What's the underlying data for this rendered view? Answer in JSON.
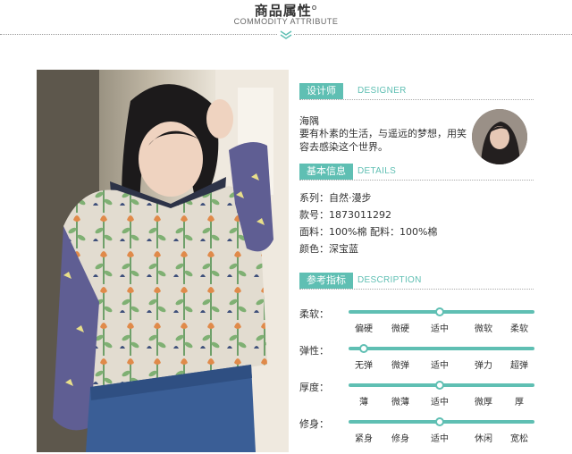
{
  "header": {
    "title": "商品属性",
    "title_mark": "o",
    "subtitle": "COMMODITY ATTRIBUTE"
  },
  "photo": {
    "icon": "model-photo-icon"
  },
  "designer": {
    "tag": "设计师",
    "tag_en": "DESIGNER",
    "name": "海隅",
    "desc": "要有朴素的生活，与遥远的梦想，用笑容去感染这个世界。",
    "avatar_icon": "designer-avatar-icon"
  },
  "details": {
    "tag": "基本信息",
    "tag_en": "DETAILS",
    "rows": [
      "系列：自然·漫步",
      "款号：1873011292",
      "面料：100%棉 配料：100%棉",
      "颜色：深宝蓝"
    ]
  },
  "description": {
    "tag": "参考指标",
    "tag_en": "DESCRIPTION",
    "indicators": [
      {
        "label": "柔软：",
        "options": [
          "偏硬",
          "微硬",
          "适中",
          "微软",
          "柔软"
        ],
        "selected": 2
      },
      {
        "label": "弹性：",
        "options": [
          "无弹",
          "微弹",
          "适中",
          "弹力",
          "超弹"
        ],
        "selected": 0
      },
      {
        "label": "厚度：",
        "options": [
          "薄",
          "微薄",
          "适中",
          "微厚",
          "厚"
        ],
        "selected": 2
      },
      {
        "label": "修身：",
        "options": [
          "紧身",
          "修身",
          "适中",
          "休闲",
          "宽松"
        ],
        "selected": 2
      }
    ]
  },
  "colors": {
    "accent": "#5fbfb3"
  }
}
